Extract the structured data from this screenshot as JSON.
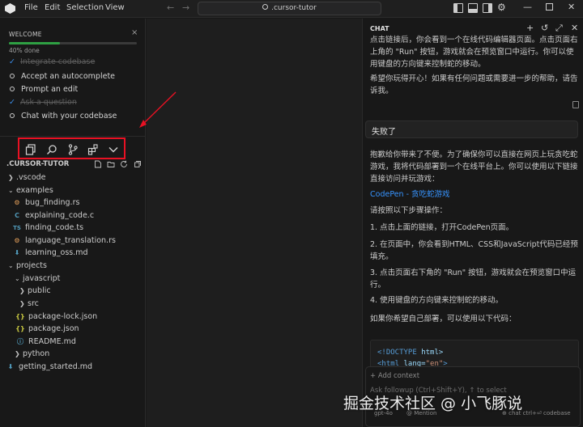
{
  "titlebar": {
    "menus": [
      "File",
      "Edit",
      "Selection",
      "View"
    ],
    "search_text": ".cursor-tutor"
  },
  "welcome": {
    "title": "WELCOME",
    "progress_percent": 40,
    "progress_label": "40% done",
    "steps": [
      {
        "label": "Integrate codebase",
        "done": true
      },
      {
        "label": "Accept an autocomplete",
        "done": false
      },
      {
        "label": "Prompt an edit",
        "done": false
      },
      {
        "label": "Ask a question",
        "done": true
      },
      {
        "label": "Chat with your codebase",
        "done": false
      }
    ]
  },
  "explorer": {
    "root": ".CURSOR-TUTOR",
    "items": [
      {
        "label": ".vscode",
        "type": "folder",
        "depth": 0,
        "open": false
      },
      {
        "label": "examples",
        "type": "folder",
        "depth": 0,
        "open": true
      },
      {
        "label": "bug_finding.rs",
        "type": "rs",
        "depth": 1
      },
      {
        "label": "explaining_code.c",
        "type": "c",
        "depth": 1
      },
      {
        "label": "finding_code.ts",
        "type": "ts",
        "depth": 1
      },
      {
        "label": "language_translation.rs",
        "type": "rs",
        "depth": 1
      },
      {
        "label": "learning_oss.md",
        "type": "md",
        "depth": 1
      },
      {
        "label": "projects",
        "type": "folder",
        "depth": 0,
        "open": true
      },
      {
        "label": "javascript",
        "type": "folder",
        "depth": 1,
        "open": true
      },
      {
        "label": "public",
        "type": "folder",
        "depth": 2,
        "open": false
      },
      {
        "label": "src",
        "type": "folder",
        "depth": 2,
        "open": false
      },
      {
        "label": "package-lock.json",
        "type": "json",
        "depth": 2
      },
      {
        "label": "package.json",
        "type": "json",
        "depth": 2
      },
      {
        "label": "README.md",
        "type": "md",
        "depth": 2
      },
      {
        "label": "python",
        "type": "folder",
        "depth": 1,
        "open": false
      },
      {
        "label": "getting_started.md",
        "type": "md",
        "depth": 0
      }
    ]
  },
  "chat": {
    "title": "CHAT",
    "top_text_1": "点击链接后，你会看到一个在线代码编辑器页面。点击页面右上角的 \"Run\" 按钮，游戏就会在预览窗口中运行。你可以使用键盘的方向键来控制蛇的移动。",
    "top_text_2": "希望你玩得开心！如果有任何问题或需要进一步的帮助，请告诉我。",
    "user_message": "失败了",
    "reply_intro": "抱歉给你带来了不便。为了确保你可以直接在网页上玩贪吃蛇游戏，我将代码部署到一个在线平台上。你可以使用以下链接直接访问并玩游戏：",
    "link_text": "CodePen - 贪吃蛇游戏",
    "steps_intro": "请按照以下步骤操作：",
    "step1": "1. 点击上面的链接，打开CodePen页面。",
    "step2": "2. 在页面中，你会看到HTML、CSS和JavaScript代码已经预填充。",
    "step3": "3. 点击页面右下角的 \"Run\" 按钮，游戏就会在预览窗口中运行。",
    "step4": "4. 使用键盘的方向键来控制蛇的移动。",
    "deploy_text": "如果你希望自己部署，可以使用以下代码：",
    "code_line1_a": "<!DOCTYPE",
    "code_line1_b": " html>",
    "code_line2_a": "<html",
    "code_line2_b": " lang=",
    "code_line2_c": "\"en\"",
    "code_line2_d": ">",
    "add_context": "Add context",
    "followup_placeholder": "Ask followup (Ctrl+Shift+Y), ↑ to select",
    "model": "gpt-4o",
    "mention": "@ Mention",
    "shortcut": "⊕ chat  ctrl+⏎ codebase"
  },
  "watermark": "掘金技术社区 @ 小飞豚说",
  "colors": {
    "annotation": "#e81123",
    "progress": "#2ea043",
    "link": "#3794ff"
  }
}
